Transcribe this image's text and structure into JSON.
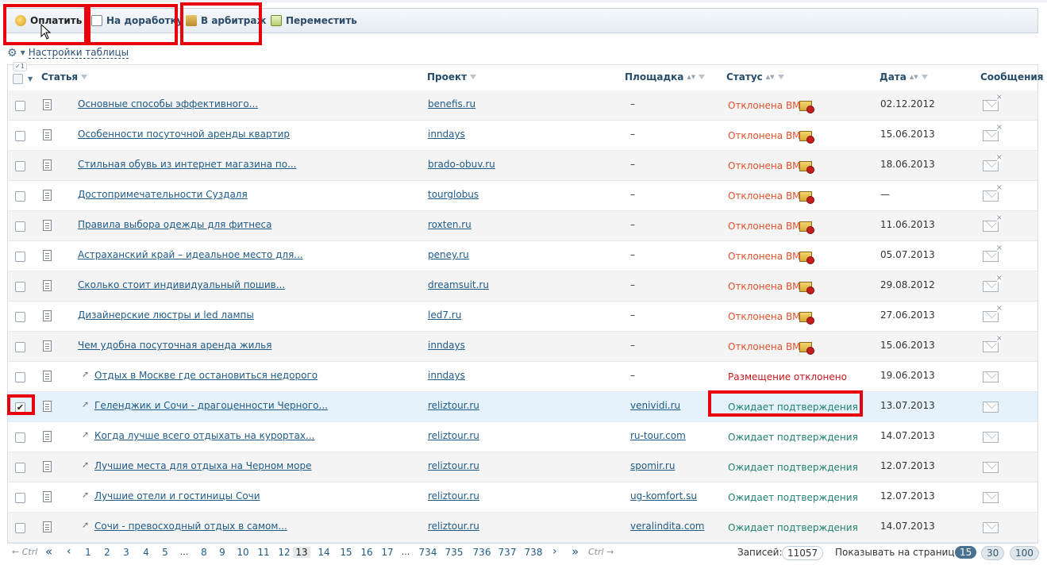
{
  "toolbar": {
    "pay": "Оплатить",
    "rework": "На доработку",
    "arbitrage": "В арбитраж",
    "move": "Переместить"
  },
  "settings_label": "Настройки таблицы",
  "selected_badge": "1",
  "headers": {
    "article": "Статья",
    "project": "Проект",
    "platform": "Площадка",
    "status": "Статус",
    "date": "Дата",
    "messages": "Сообщения"
  },
  "rows": [
    {
      "title": "Основные способы эффективного...",
      "project": "benefis.ru",
      "platform": "–",
      "status": "Отклонена ВМ",
      "date": "02.12.2012"
    },
    {
      "title": "Особенности посуточной аренды квартир",
      "project": "inndays",
      "platform": "–",
      "status": "Отклонена ВМ",
      "date": "15.06.2013"
    },
    {
      "title": "Стильная обувь из интернет магазина по...",
      "project": "brado-obuv.ru",
      "platform": "–",
      "status": "Отклонена ВМ",
      "date": "18.06.2013"
    },
    {
      "title": "Достопримечательности Суздаля",
      "project": "tourglobus",
      "platform": "–",
      "status": "Отклонена ВМ",
      "date": "—"
    },
    {
      "title": "Правила выбора одежды для фитнеса",
      "project": "roxten.ru",
      "platform": "–",
      "status": "Отклонена ВМ",
      "date": "11.06.2013"
    },
    {
      "title": "Астраханский край – идеальное место для...",
      "project": "peney.ru",
      "platform": "–",
      "status": "Отклонена ВМ",
      "date": "05.07.2013"
    },
    {
      "title": "Сколько стоит индивидуальный пошив...",
      "project": "dreamsuit.ru",
      "platform": "–",
      "status": "Отклонена ВМ",
      "date": "29.08.2012"
    },
    {
      "title": "Дизайнерские люстры и led лампы",
      "project": "led7.ru",
      "platform": "–",
      "status": "Отклонена ВМ",
      "date": "27.06.2013"
    },
    {
      "title": "Чем удобна посуточная аренда жилья",
      "project": "inndays",
      "platform": "–",
      "status": "Отклонена ВМ",
      "date": "15.06.2013"
    },
    {
      "title": "Отдых в Москве где остановиться недорого",
      "project": "inndays",
      "platform": "–",
      "status": "Размещение отклонено",
      "date": "19.06.2013"
    },
    {
      "title": "Геленджик и Сочи - драгоценности Черного...",
      "project": "reliztour.ru",
      "platform": "venividi.ru",
      "status": "Ожидает подтверждения",
      "date": "13.07.2013"
    },
    {
      "title": "Когда лучше всего отдыхать на курортах...",
      "project": "reliztour.ru",
      "platform": "ru-tour.com",
      "status": "Ожидает подтверждения",
      "date": "14.07.2013"
    },
    {
      "title": "Лучшие места для отдыха на Черном море",
      "project": "reliztour.ru",
      "platform": "spomir.ru",
      "status": "Ожидает подтверждения",
      "date": "12.07.2013"
    },
    {
      "title": "Лучшие отели и гостиницы Сочи",
      "project": "reliztour.ru",
      "platform": "ug-komfort.su",
      "status": "Ожидает подтверждения",
      "date": "12.07.2013"
    },
    {
      "title": "Сочи - превосходный отдых в самом...",
      "project": "reliztour.ru",
      "platform": "veralindita.com",
      "status": "Ожидает подтверждения",
      "date": "14.07.2013"
    }
  ],
  "pager": {
    "prev_hint": "← Ctrl",
    "next_hint": "Ctrl →",
    "first": "«",
    "prev": "‹",
    "next": "›",
    "last": "»",
    "pages": [
      "1",
      "2",
      "3",
      "4",
      "5",
      "...",
      "8",
      "9",
      "10",
      "11",
      "12",
      "13",
      "14",
      "15",
      "16",
      "17",
      "...",
      "734",
      "735",
      "736",
      "737",
      "738"
    ],
    "current": "13",
    "records_label": "Записей:",
    "records_count": "11057",
    "per_page_label": "Показывать на странице:",
    "per_page_options": [
      "15",
      "30",
      "100"
    ],
    "per_page_selected": "15"
  },
  "colors": {
    "accent": "#1f5a87",
    "rejected": "#e0512b",
    "declined": "#c8141c",
    "pending": "#20826f",
    "highlight": "#e8000b"
  }
}
